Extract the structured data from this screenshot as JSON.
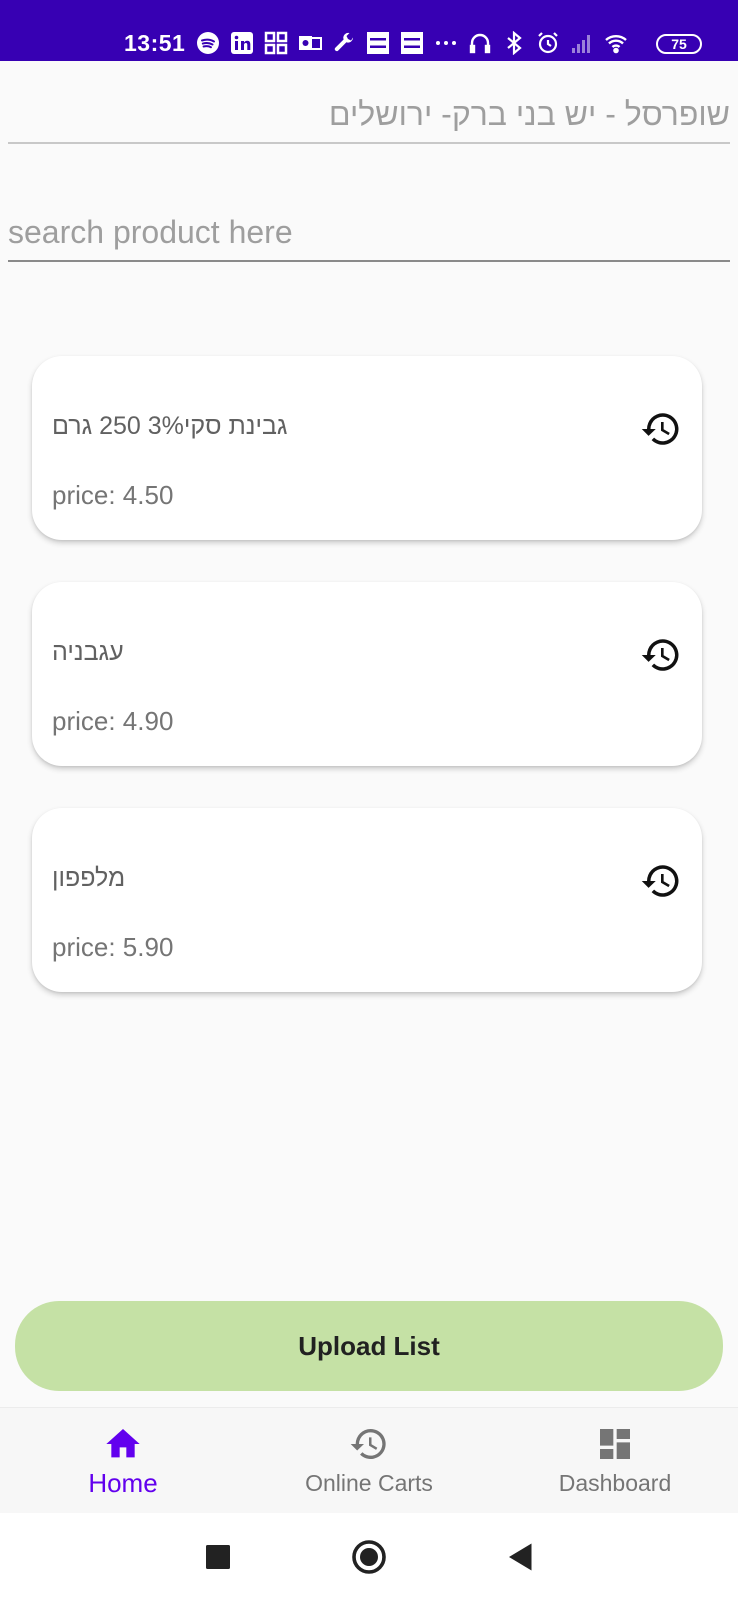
{
  "status_bar": {
    "time": "13:51",
    "battery": "75",
    "icons": [
      "spotify-icon",
      "linkedin-icon",
      "qr-icon",
      "outlook-icon",
      "wrench-icon",
      "menu-box-icon",
      "menu-box-icon",
      "more-icon",
      "headphones-icon",
      "bluetooth-icon",
      "alarm-icon",
      "signal-icon",
      "wifi-icon",
      "battery-icon"
    ],
    "background": "#3700b3"
  },
  "store": {
    "name": "שופרסל - יש בני ברק- ירושלים"
  },
  "search": {
    "placeholder": "search product here",
    "value": ""
  },
  "products": [
    {
      "name": "גבינת סקי3% 250 גרם",
      "price": "price: 4.50",
      "icon": "history-icon"
    },
    {
      "name": "עגבניה",
      "price": "price: 4.90",
      "icon": "history-icon"
    },
    {
      "name": "מלפפון",
      "price": "price: 5.90",
      "icon": "history-icon"
    }
  ],
  "upload_button": {
    "label": "Upload List",
    "color": "#c5e1a5"
  },
  "bottom_nav": {
    "active_color": "#6200ee",
    "items": [
      {
        "label": "Home",
        "icon": "home-icon",
        "active": true
      },
      {
        "label": "Online Carts",
        "icon": "history-icon",
        "active": false
      },
      {
        "label": "Dashboard",
        "icon": "dashboard-icon",
        "active": false
      }
    ]
  },
  "system_nav": {
    "buttons": [
      "recents-icon",
      "home-circle-icon",
      "back-icon"
    ]
  }
}
